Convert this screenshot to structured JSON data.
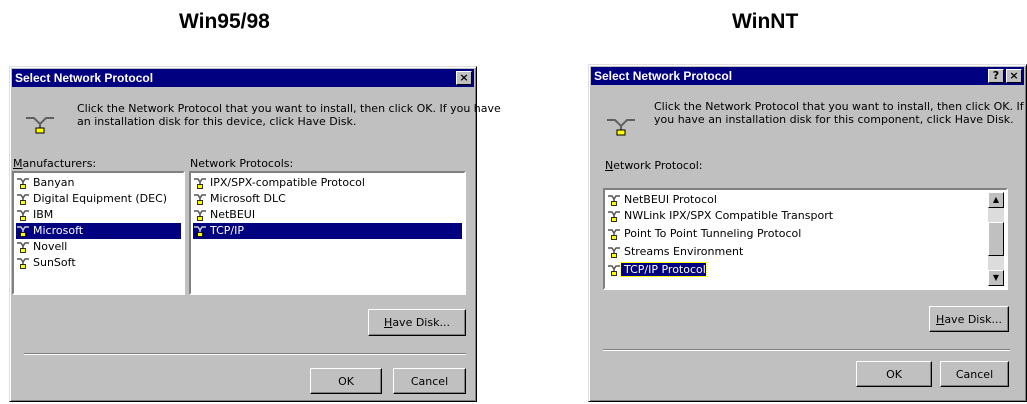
{
  "headings": {
    "left": "Win95/98",
    "right": "WinNT"
  },
  "icon_semantic": "network-protocol-icon",
  "win95": {
    "title": "Select Network Protocol",
    "close_glyph": "×",
    "instructions_line1": "Click the Network Protocol that you want to install, then click OK. If you have",
    "instructions_line2": "an installation disk for this device, click Have Disk.",
    "manufacturers_label_m": "M",
    "manufacturers_label_rest": "anufacturers:",
    "protocols_label": "Network Protocols:",
    "manufacturers": [
      "Banyan",
      "Digital Equipment (DEC)",
      "IBM",
      "Microsoft",
      "Novell",
      "SunSoft"
    ],
    "manufacturers_selected": "Microsoft",
    "protocols": [
      "IPX/SPX-compatible Protocol",
      "Microsoft DLC",
      "NetBEUI",
      "TCP/IP"
    ],
    "protocols_selected": "TCP/IP",
    "have_disk_h": "H",
    "have_disk_rest": "ave Disk...",
    "ok_label": "OK",
    "cancel_label": "Cancel"
  },
  "winnt": {
    "title": "Select Network Protocol",
    "help_glyph": "?",
    "close_glyph": "×",
    "instructions_line1": "Click the Network Protocol that you want to install, then click OK.  If",
    "instructions_line2": "you have an installation disk for this component, click Have Disk.",
    "protocol_label_n": "N",
    "protocol_label_rest": "etwork Protocol:",
    "protocols": [
      "NetBEUI Protocol",
      "NWLink IPX/SPX Compatible Transport",
      "Point To Point Tunneling Protocol",
      "Streams Environment",
      "TCP/IP Protocol"
    ],
    "protocols_selected": "TCP/IP Protocol",
    "scroll_up_glyph": "▲",
    "scroll_down_glyph": "▼",
    "have_disk_h": "H",
    "have_disk_rest": "ave Disk...",
    "ok_label": "OK",
    "cancel_label": "Cancel"
  },
  "colors": {
    "dialog_face": "#c0c0c0",
    "titlebar": "#000080",
    "selection": "#000080",
    "list_background": "#ffffff"
  }
}
